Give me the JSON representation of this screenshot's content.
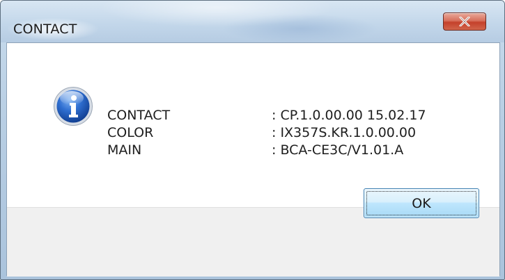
{
  "window": {
    "title": "CONTACT",
    "close_icon": "close-x-icon"
  },
  "dialog": {
    "icon": "info-icon",
    "rows": [
      {
        "label": "CONTACT",
        "value": ": CP.1.0.00.00 15.02.17"
      },
      {
        "label": "COLOR",
        "value": ": IX357S.KR.1.0.00.00"
      },
      {
        "label": "MAIN",
        "value": ": BCA-CE3C/V1.01.A"
      }
    ],
    "ok_label": "OK"
  }
}
